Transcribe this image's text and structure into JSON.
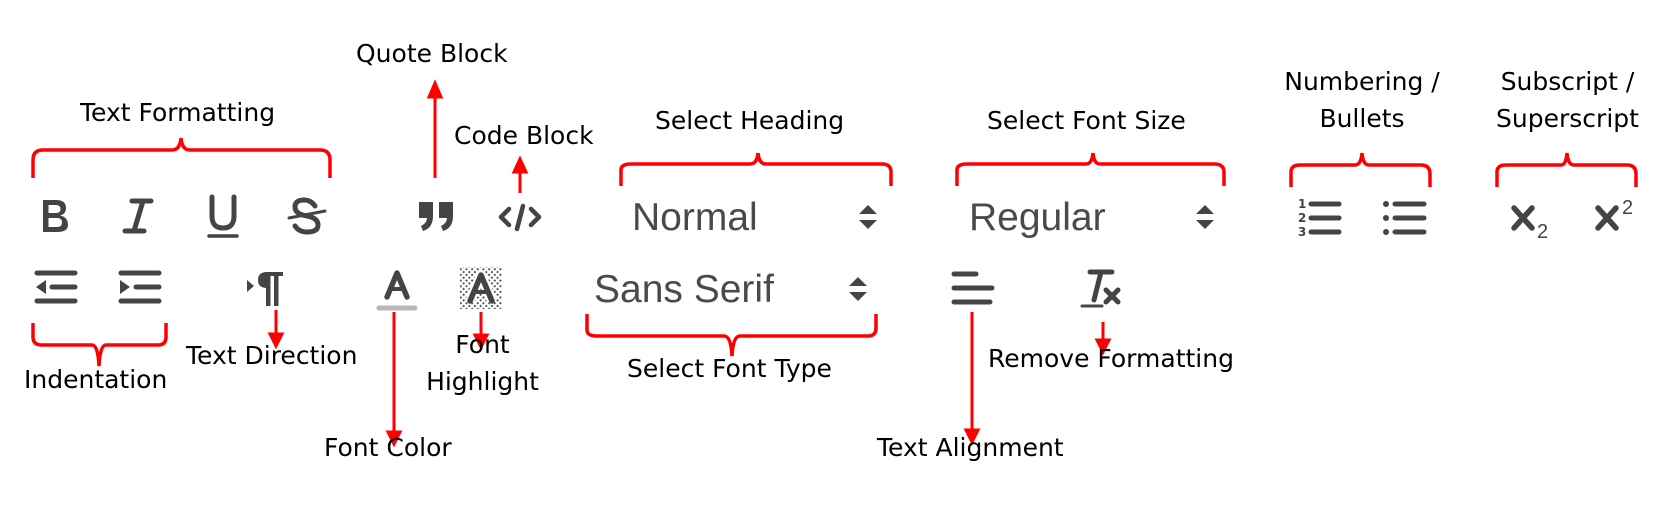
{
  "title": "Rich text editor toolbar annotated diagram",
  "colors": {
    "annotation": "#ff0000",
    "icon": "#444444",
    "text": "#000000",
    "select_text": "#4a4a4a",
    "font_color_bar": "#b8b8b8"
  },
  "annotations": {
    "text_formatting": "Text Formatting",
    "quote_block": "Quote Block",
    "code_block": "Code Block",
    "select_heading": "Select Heading",
    "select_font_size": "Select Font Size",
    "numbering_bullets_line1": "Numbering /",
    "numbering_bullets_line2": "Bullets",
    "subscript_superscript_line1": "Subscript /",
    "subscript_superscript_line2": "Superscript",
    "indentation": "Indentation",
    "text_direction": "Text Direction",
    "font_color": "Font Color",
    "font_highlight_line1": "Font",
    "font_highlight_line2": "Highlight",
    "select_font_type": "Select Font Type",
    "text_alignment": "Text Alignment",
    "remove_formatting": "Remove Formatting"
  },
  "toolbar": {
    "heading_select": {
      "value": "Normal",
      "icon": "updown-caret-icon"
    },
    "font_size_select": {
      "value": "Regular",
      "icon": "updown-caret-icon"
    },
    "font_type_select": {
      "value": "Sans Serif",
      "icon": "updown-caret-icon"
    },
    "buttons": {
      "bold": "B",
      "italic": "I",
      "underline": "U",
      "strike": "S",
      "subscript_base": "x",
      "subscript_index": "2",
      "superscript_base": "x",
      "superscript_index": "2",
      "font_color": "A",
      "font_highlight": "A",
      "pilcrow": "¶"
    }
  }
}
